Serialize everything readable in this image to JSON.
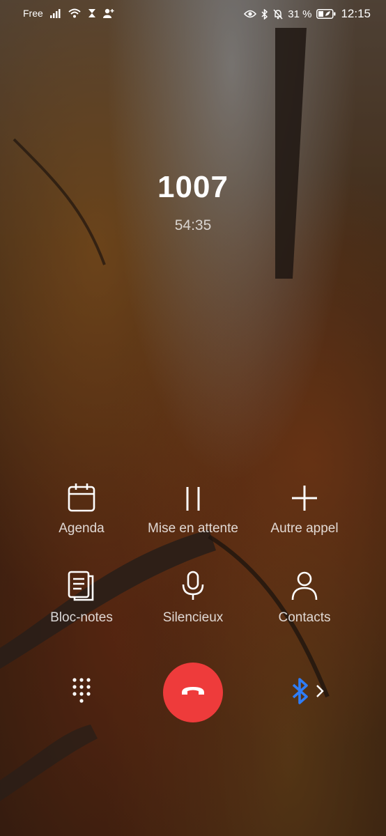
{
  "status_bar": {
    "carrier": "Free",
    "battery_percent": "31 %",
    "time": "12:15",
    "icons": [
      "signal-icon",
      "wifi-icon",
      "hourglass-icon",
      "person-add-icon",
      "eye-icon",
      "bluetooth-icon",
      "mute-bell-icon",
      "battery-icon"
    ]
  },
  "call": {
    "name": "1007",
    "duration": "54:35"
  },
  "actions": [
    {
      "label": "Agenda",
      "icon": "calendar-icon"
    },
    {
      "label": "Mise en attente",
      "icon": "pause-icon"
    },
    {
      "label": "Autre appel",
      "icon": "plus-icon"
    },
    {
      "label": "Bloc-notes",
      "icon": "notes-icon"
    },
    {
      "label": "Silencieux",
      "icon": "microphone-icon"
    },
    {
      "label": "Contacts",
      "icon": "contact-icon"
    }
  ],
  "bottom": {
    "keypad_icon": "dialpad-icon",
    "end_call_icon": "hang-up-icon",
    "audio_route_icon": "bluetooth-icon",
    "end_call_color": "#ee3b3b",
    "bluetooth_color": "#2f7df6"
  }
}
